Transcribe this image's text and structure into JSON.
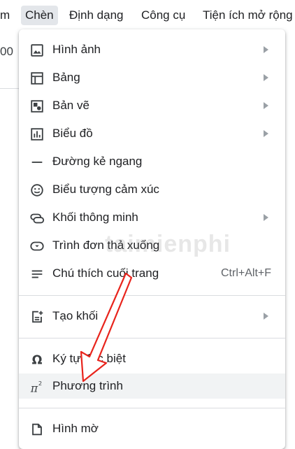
{
  "menubar": {
    "items": [
      {
        "label": "m"
      },
      {
        "label": "Chèn"
      },
      {
        "label": "Định dạng"
      },
      {
        "label": "Công cụ"
      },
      {
        "label": "Tiện ích mở rộng"
      }
    ]
  },
  "background": {
    "text": "00"
  },
  "menu": {
    "items": [
      {
        "label": "Hình ảnh",
        "icon": "image-icon"
      },
      {
        "label": "Bảng",
        "icon": "table-icon"
      },
      {
        "label": "Bản vẽ",
        "icon": "drawing-icon"
      },
      {
        "label": "Biểu đồ",
        "icon": "chart-icon"
      },
      {
        "label": "Đường kẻ ngang",
        "icon": "horizontal-line-icon"
      },
      {
        "label": "Biểu tượng cảm xúc",
        "icon": "emoji-icon"
      },
      {
        "label": "Khối thông minh",
        "icon": "smart-chip-icon"
      },
      {
        "label": "Trình đơn thả xuống",
        "icon": "dropdown-icon"
      },
      {
        "label": "Chú thích cuối trang",
        "icon": "footnote-icon",
        "shortcut": "Ctrl+Alt+F"
      },
      {
        "label": "Tạo khối",
        "icon": "building-blocks-icon"
      },
      {
        "label": "Ký tự đặc biệt",
        "icon": "omega-icon"
      },
      {
        "label": "Phương trình",
        "icon": "pi-squared-icon"
      },
      {
        "label": "Hình mờ",
        "icon": "watermark-icon"
      }
    ]
  },
  "watermark": {
    "text": "taimienphi"
  },
  "colors": {
    "arrow": "#e8241c",
    "highlight": "#f1f3f4"
  }
}
